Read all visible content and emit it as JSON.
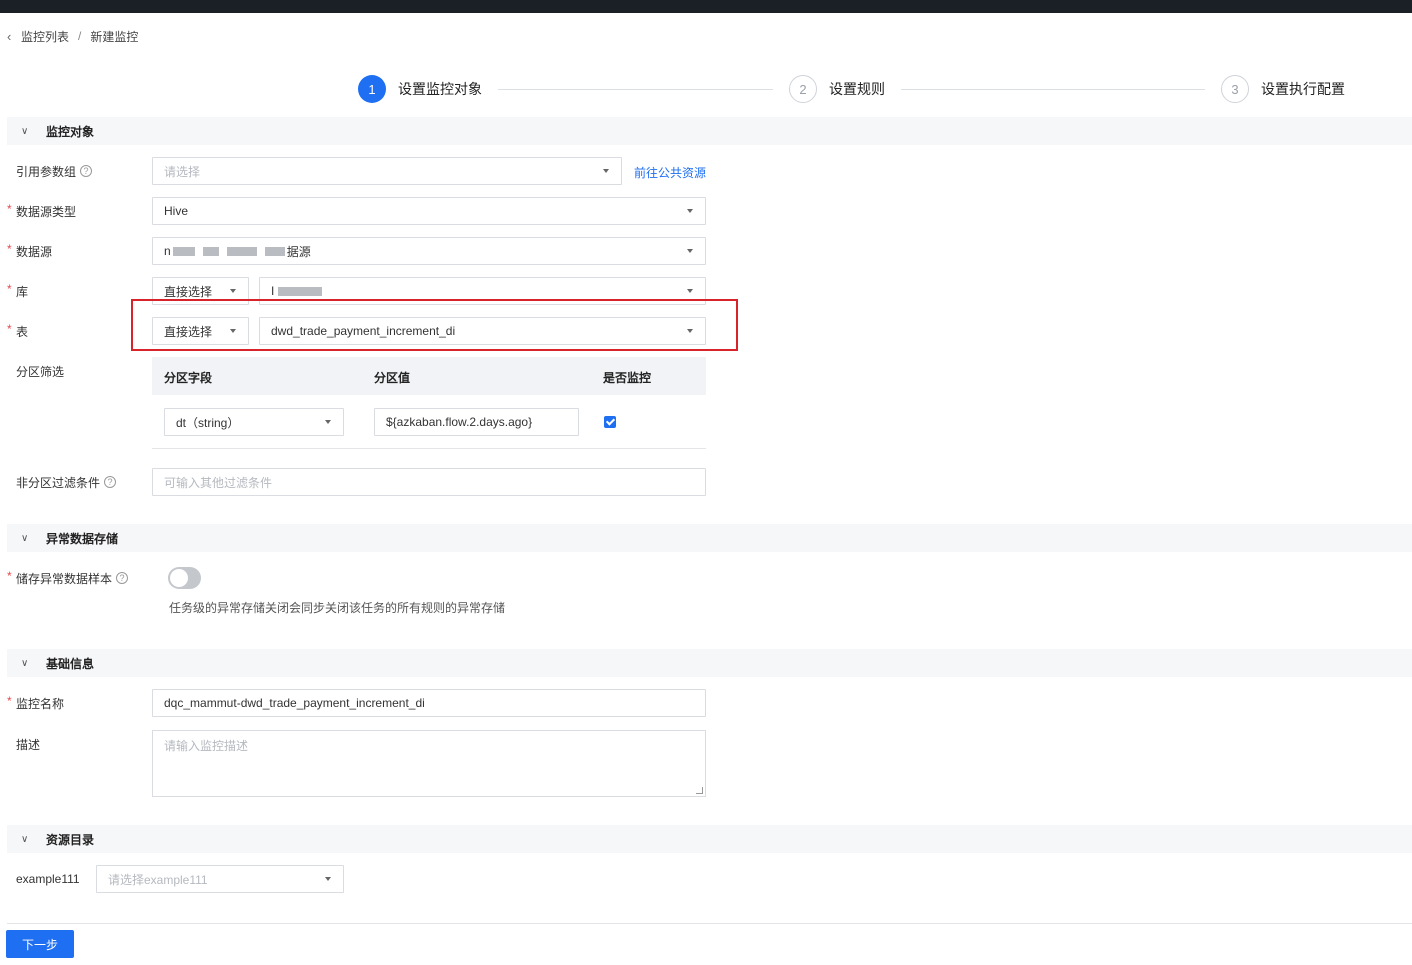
{
  "breadcrumb": {
    "parent": "监控列表",
    "separator": "/",
    "current": "新建监控"
  },
  "steps": [
    {
      "number": "1",
      "label": "设置监控对象",
      "state": "active"
    },
    {
      "number": "2",
      "label": "设置规则",
      "state": "inactive"
    },
    {
      "number": "3",
      "label": "设置执行配置",
      "state": "inactive"
    }
  ],
  "sections": {
    "monitor_object": "监控对象",
    "abnormal_storage": "异常数据存储",
    "basic_info": "基础信息",
    "resource_catalog": "资源目录"
  },
  "form": {
    "param_group": {
      "label": "引用参数组",
      "placeholder": "请选择",
      "link": "前往公共资源"
    },
    "datasource_type": {
      "label": "数据源类型",
      "value": "Hive"
    },
    "datasource": {
      "label": "数据源",
      "value_prefix": "n",
      "value_suffix": "据源"
    },
    "database": {
      "label": "库",
      "mode": "直接选择",
      "value_prefix": "I"
    },
    "table": {
      "label": "表",
      "mode": "直接选择",
      "value": "dwd_trade_payment_increment_di"
    },
    "partition": {
      "label": "分区筛选",
      "headers": {
        "field": "分区字段",
        "value": "分区值",
        "monitor": "是否监控"
      },
      "row": {
        "field": "dt（string）",
        "value": "${azkaban.flow.2.days.ago}",
        "monitored": true
      }
    },
    "non_partition_filter": {
      "label": "非分区过滤条件",
      "placeholder": "可输入其他过滤条件"
    },
    "store_sample": {
      "label": "储存异常数据样本",
      "enabled": false,
      "hint": "任务级的异常存储关闭会同步关闭该任务的所有规则的异常存储"
    },
    "monitor_name": {
      "label": "监控名称",
      "value": "dqc_mammut-dwd_trade_payment_increment_di"
    },
    "description": {
      "label": "描述",
      "placeholder": "请输入监控描述"
    },
    "catalog": {
      "label": "example111",
      "placeholder": "请选择example111"
    }
  },
  "actions": {
    "next": "下一步"
  },
  "colors": {
    "primary": "#1f6ff2",
    "required": "#e5484d",
    "highlight": "#d9232a"
  }
}
